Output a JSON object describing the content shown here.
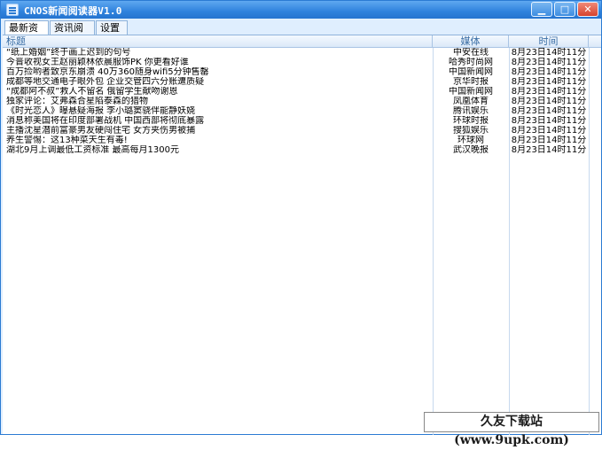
{
  "window": {
    "title": "CNOS新闻阅读器V1.0",
    "buttons": {
      "minimize": "▁",
      "maximize": "□",
      "close": "✕"
    }
  },
  "tabs": [
    {
      "label": "最新资讯"
    },
    {
      "label": "资讯阅读"
    },
    {
      "label": "设置"
    }
  ],
  "columns": {
    "title": "标题",
    "source": "媒体",
    "time": "时间"
  },
  "rows": [
    {
      "title": "“纸上婚姻”终于画上迟到的句号",
      "source": "中安在线",
      "time": "8月23日14时11分"
    },
    {
      "title": "今晋收视女王赵丽颖林依晨服饰PK 你更看好谁",
      "source": "哈秀时尚网",
      "time": "8月23日14时11分"
    },
    {
      "title": "百万捡哟者致京东崩溃 40万360随身wifi5分钟售罄",
      "source": "中国新闻网",
      "time": "8月23日14时11分"
    },
    {
      "title": "成都等地交通电子眼外包 企业交管四六分账遭质疑",
      "source": "京华时报",
      "time": "8月23日14时11分"
    },
    {
      "title": "“成都阿不叔”救人不留名 俄留学生献吻谢恩",
      "source": "中国新闻网",
      "time": "8月23日14时11分"
    },
    {
      "title": "独家评论：艾弗森合星陷泰森的猎物",
      "source": "凤凰体育",
      "time": "8月23日14时11分"
    },
    {
      "title": "《时光恋人》曝悬疑海报 李小璐窦骁伴能静妖娆",
      "source": "腾讯娱乐",
      "time": "8月23日14时11分"
    },
    {
      "title": "消息称美国将在印度部署战机 中国西部将彻底暴露",
      "source": "环球时报",
      "time": "8月23日14时11分"
    },
    {
      "title": "主播沈星潜前富豪男友硬闯住宅 女方夹伤男被捕",
      "source": "搜狐娱乐",
      "time": "8月23日14时11分"
    },
    {
      "title": "养生警惕：这13种菜天生有毒!",
      "source": "环球网",
      "time": "8月23日14时11分"
    },
    {
      "title": "湖北9月上调最低工资标准 最高每月1300元",
      "source": "武汉晚报",
      "time": "8月23日14时11分"
    }
  ],
  "watermark": "久友下载站(www.9upk.com)"
}
